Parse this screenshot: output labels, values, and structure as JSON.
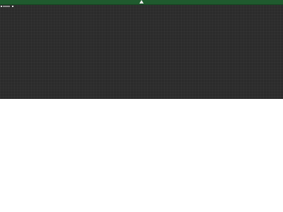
{
  "app": {
    "topbar_color": "#1f5a2e",
    "canvas_color": "#2b2b2b",
    "logo_icon": "tree-logo-icon"
  },
  "toolbar": {
    "menu_icon": "menu-icon",
    "close_icon": "close-icon"
  },
  "message": {
    "line1": "",
    "line2": ""
  }
}
